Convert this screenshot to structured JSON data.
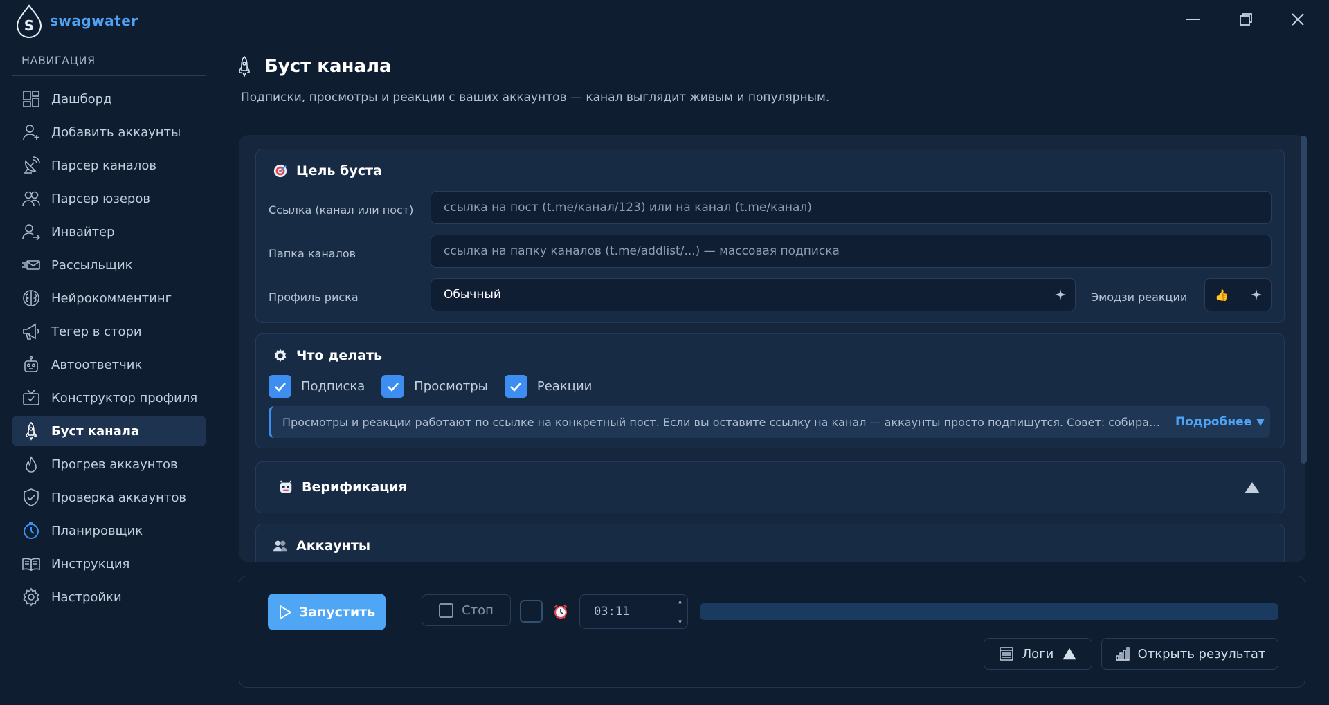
{
  "app": {
    "name": "swagwater"
  },
  "sidebar": {
    "title": "НАВИГАЦИЯ",
    "items": [
      {
        "label": "Дашборд",
        "icon": "dashboard-icon"
      },
      {
        "label": "Добавить аккаунты",
        "icon": "user-add-icon"
      },
      {
        "label": "Парсер каналов",
        "icon": "satellite-icon"
      },
      {
        "label": "Парсер юзеров",
        "icon": "users-icon"
      },
      {
        "label": "Инвайтер",
        "icon": "user-invite-icon"
      },
      {
        "label": "Рассыльщик",
        "icon": "mail-send-icon"
      },
      {
        "label": "Нейрокомментинг",
        "icon": "brain-icon"
      },
      {
        "label": "Тегер в стори",
        "icon": "megaphone-icon"
      },
      {
        "label": "Автоответчик",
        "icon": "robot-icon"
      },
      {
        "label": "Конструктор профиля",
        "icon": "tv-icon"
      },
      {
        "label": "Буст канала",
        "icon": "rocket-icon",
        "active": true
      },
      {
        "label": "Прогрев аккаунтов",
        "icon": "flame-icon"
      },
      {
        "label": "Проверка аккаунтов",
        "icon": "shield-check-icon"
      },
      {
        "label": "Планировщик",
        "icon": "timer-icon"
      },
      {
        "label": "Инструкция",
        "icon": "book-icon"
      },
      {
        "label": "Настройки",
        "icon": "gear-icon"
      }
    ]
  },
  "page": {
    "title": "Буст канала",
    "subtitle": "Подписки, просмотры и реакции с ваших аккаунтов — канал выглядит живым и популярным."
  },
  "target": {
    "heading": "Цель буста",
    "link_label": "Ссылка (канал или пост)",
    "link_value": "",
    "link_placeholder": "ссылка на пост (t.me/канал/123) или на канал (t.me/канал)",
    "folder_label": "Папка каналов",
    "folder_value": "",
    "folder_placeholder": "ссылка на папку каналов (t.me/addlist/...) — массовая подписка",
    "risk_label": "Профиль риска",
    "risk_value": "Обычный",
    "emoji_label": "Эмодзи реакции",
    "emoji_value": "👍"
  },
  "actions": {
    "heading": "Что делать",
    "options": [
      {
        "label": "Подписка",
        "checked": true
      },
      {
        "label": "Просмотры",
        "checked": true
      },
      {
        "label": "Реакции",
        "checked": true
      }
    ],
    "info": "Просмотры и реакции работают по ссылке на конкретный пост. Если вы оставите ссылку на канал — аккаунты просто подпишутся. Совет: собирайте пары каналов и постов заранее.",
    "more": "Подробнее"
  },
  "verification": {
    "heading": "Верификация"
  },
  "accounts": {
    "heading": "Аккаунты"
  },
  "controls": {
    "start": "Запустить",
    "stop": "Стоп",
    "schedule_enabled": false,
    "time": "03:11",
    "progress": 0,
    "logs": "Логи",
    "open_result": "Открыть результат"
  },
  "colors": {
    "accent": "#4fa6f5",
    "background": "#0f1d30",
    "card": "#182b44"
  }
}
